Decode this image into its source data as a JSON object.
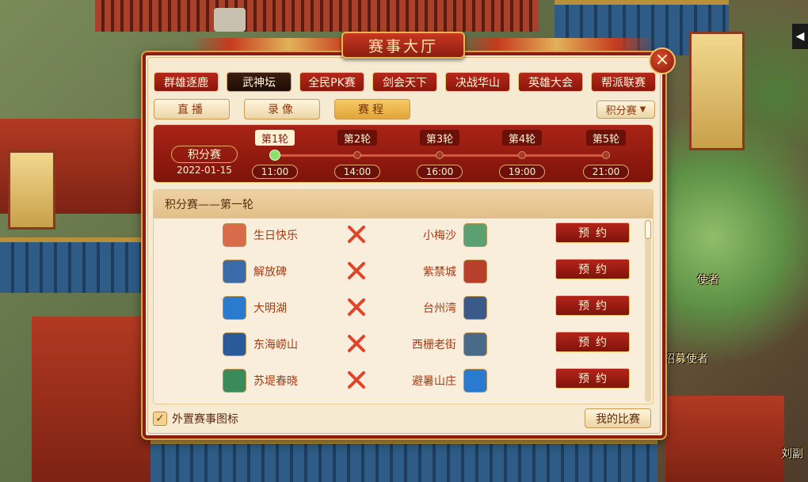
{
  "window": {
    "title": "赛事大厅",
    "close_icon": "×"
  },
  "categories": [
    {
      "label": "群雄逐鹿",
      "active": false
    },
    {
      "label": "武神坛",
      "active": true
    },
    {
      "label": "全民PK赛",
      "active": false
    },
    {
      "label": "剑会天下",
      "active": false
    },
    {
      "label": "决战华山",
      "active": false
    },
    {
      "label": "英雄大会",
      "active": false
    },
    {
      "label": "帮派联赛",
      "active": false
    }
  ],
  "sub_tabs": [
    {
      "label": "直播",
      "active": false
    },
    {
      "label": "录像",
      "active": false
    },
    {
      "label": "赛程",
      "active": true
    }
  ],
  "stage_dropdown": {
    "value": "积分赛",
    "caret": "▼"
  },
  "timeline": {
    "stage": "积分赛",
    "date": "2022-01-15",
    "rounds": [
      {
        "label": "第1轮",
        "time": "11:00",
        "active": true
      },
      {
        "label": "第2轮",
        "time": "14:00",
        "active": false
      },
      {
        "label": "第3轮",
        "time": "16:00",
        "active": false
      },
      {
        "label": "第4轮",
        "time": "19:00",
        "active": false
      },
      {
        "label": "第5轮",
        "time": "21:00",
        "active": false
      }
    ]
  },
  "list": {
    "header": "积分赛——第一轮",
    "vs_icon": "crossed-swords-icon",
    "reserve_label": "预约",
    "matches": [
      {
        "left": "生日快乐",
        "right": "小梅沙",
        "left_color": "#d96a4a",
        "right_color": "#5aa070"
      },
      {
        "left": "解放碑",
        "right": "紫禁城",
        "left_color": "#3a6aa8",
        "right_color": "#b8402a"
      },
      {
        "left": "大明湖",
        "right": "台州湾",
        "left_color": "#2a7ad0",
        "right_color": "#3a5a8a"
      },
      {
        "left": "东海崂山",
        "right": "西栅老街",
        "left_color": "#2a5a9a",
        "right_color": "#4a6a8a"
      },
      {
        "left": "苏堤春晓",
        "right": "避暑山庄",
        "left_color": "#3a8a5a",
        "right_color": "#2a7ad0"
      }
    ]
  },
  "footer": {
    "checkbox_label": "外置赛事图标",
    "checked": true,
    "check_mark": "✓",
    "my_matches_label": "我的比赛"
  },
  "scene": {
    "npc_labels": [
      "使者",
      "招募使者",
      "刘副"
    ],
    "nav_arrow": "◀"
  }
}
